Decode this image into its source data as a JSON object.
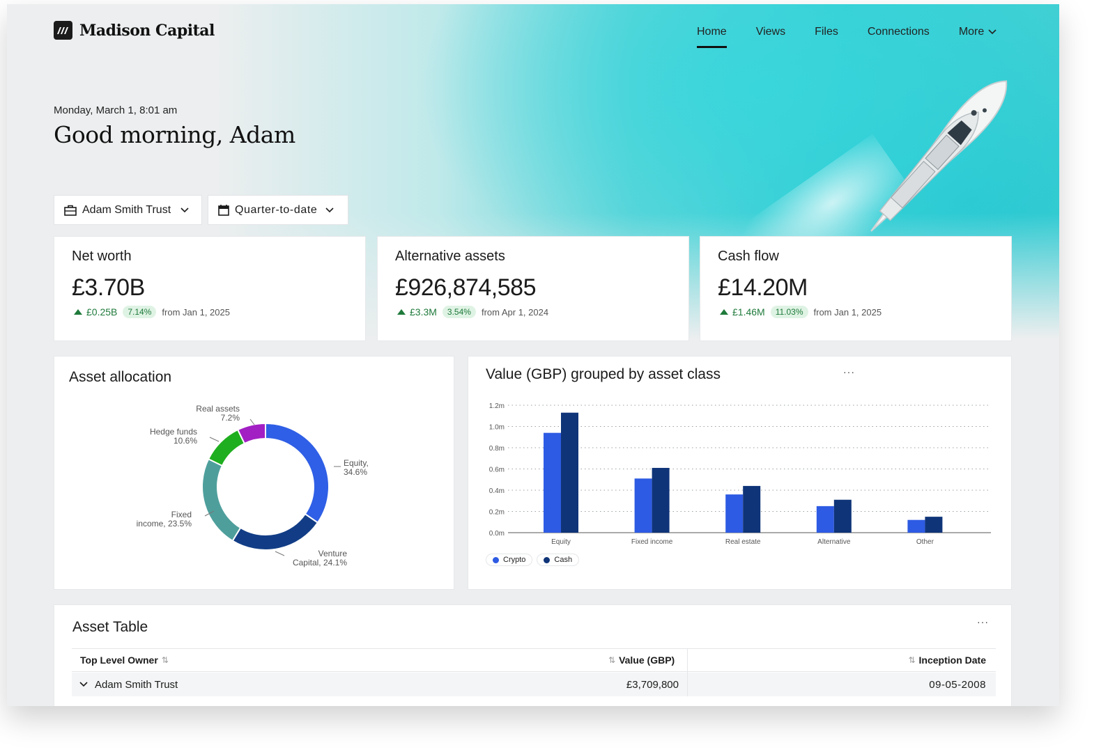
{
  "brand": {
    "name": "Madison Capital"
  },
  "nav": {
    "items": [
      "Home",
      "Views",
      "Files",
      "Connections"
    ],
    "more_label": "More",
    "active": "Home"
  },
  "header": {
    "datetime": "Monday, March 1, 8:01 am",
    "greeting": "Good morning, Adam"
  },
  "filters": {
    "entity": "Adam Smith Trust",
    "period": "Quarter-to-date"
  },
  "kpis": [
    {
      "title": "Net worth",
      "value": "£3.70B",
      "delta": "£0.25B",
      "pct": "7.14%",
      "from": "from Jan 1, 2025"
    },
    {
      "title": "Alternative assets",
      "value": "£926,874,585",
      "delta": "£3.3M",
      "pct": "3.54%",
      "from": "from Apr 1, 2024"
    },
    {
      "title": "Cash flow",
      "value": "£14.20M",
      "delta": "£1.46M",
      "pct": "11.03%",
      "from": "from Jan 1, 2025"
    }
  ],
  "allocation": {
    "title": "Asset allocation",
    "labels": {
      "real": [
        "Real assets",
        "7.2%"
      ],
      "hedge": [
        "Hedge funds",
        "10.6%"
      ],
      "equity": [
        "Equity,",
        "34.6%"
      ],
      "fixed": [
        "Fixed",
        "income, 23.5%"
      ],
      "venture": [
        "Venture",
        "Capital, 24.1%"
      ]
    }
  },
  "bar_panel": {
    "title": "Value (GBP) grouped by asset class",
    "menu": "···"
  },
  "table": {
    "title": "Asset Table",
    "menu": "···",
    "columns": {
      "owner": "Top Level Owner",
      "value": "Value (GBP)",
      "date": "Inception Date"
    },
    "rows": [
      {
        "owner": "Adam Smith Trust",
        "value": "£3,709,800",
        "date": "09-05-2008"
      }
    ]
  },
  "colors": {
    "crypto": "#2d5be3",
    "cash": "#0f3478",
    "equity": "#2f5fe6",
    "venture": "#123d86",
    "fixed": "#4e9f9c",
    "hedge": "#1fae1f",
    "real": "#a21fc4"
  },
  "chart_data": [
    {
      "type": "pie",
      "title": "Asset allocation",
      "categories": [
        "Equity",
        "Venture Capital",
        "Fixed income",
        "Hedge funds",
        "Real assets"
      ],
      "values": [
        34.6,
        24.1,
        23.5,
        10.6,
        7.2
      ],
      "unit": "%",
      "style": "donut"
    },
    {
      "type": "bar",
      "title": "Value (GBP) grouped by asset class",
      "categories": [
        "Equity",
        "Fixed income",
        "Real estate",
        "Alternative",
        "Other"
      ],
      "series": [
        {
          "name": "Crypto",
          "values": [
            0.94,
            0.51,
            0.36,
            0.25,
            0.12
          ]
        },
        {
          "name": "Cash",
          "values": [
            1.13,
            0.61,
            0.44,
            0.31,
            0.15
          ]
        }
      ],
      "yticks": [
        "0.0m",
        "0.2m",
        "0.4m",
        "0.6m",
        "0.8m",
        "1.0m",
        "1.2m"
      ],
      "ylim": [
        0,
        1.2
      ],
      "grid": true,
      "legend": "bottom-left"
    }
  ]
}
